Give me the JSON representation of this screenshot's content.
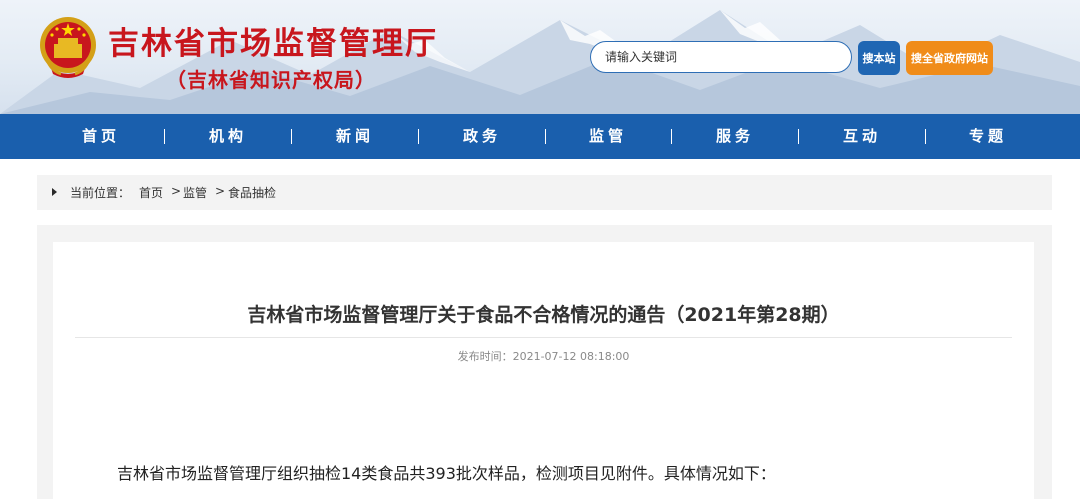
{
  "header": {
    "title": "吉林省市场监督管理厅",
    "subtitle": "（吉林省知识产权局）"
  },
  "search": {
    "placeholder": "请输入关键词",
    "site_button": "搜本站",
    "gov_button": "搜全省政府网站"
  },
  "nav": {
    "items": [
      {
        "label": "首页"
      },
      {
        "label": "机构"
      },
      {
        "label": "新闻"
      },
      {
        "label": "政务"
      },
      {
        "label": "监管"
      },
      {
        "label": "服务"
      },
      {
        "label": "互动"
      },
      {
        "label": "专题"
      }
    ]
  },
  "breadcrumb": {
    "prefix": "当前位置：",
    "items": [
      "首页",
      "监管",
      "食品抽检"
    ],
    "separator": ">"
  },
  "article": {
    "title": "吉林省市场监督管理厅关于食品不合格情况的通告（2021年第28期）",
    "publish_label": "发布时间：",
    "publish_time": "2021-07-12 08:18:00",
    "paragraph": "吉林省市场监督管理厅组织抽检14类食品共393批次样品，检测项目见附件。具体情况如下："
  },
  "colors": {
    "brand_red": "#c8161d",
    "nav_blue": "#1a5fad",
    "search_blue": "#1f66b3",
    "gov_orange": "#f08c19"
  },
  "icons": {
    "emblem": "national-emblem-icon",
    "breadcrumb_arrow": "triangle-right-icon"
  }
}
